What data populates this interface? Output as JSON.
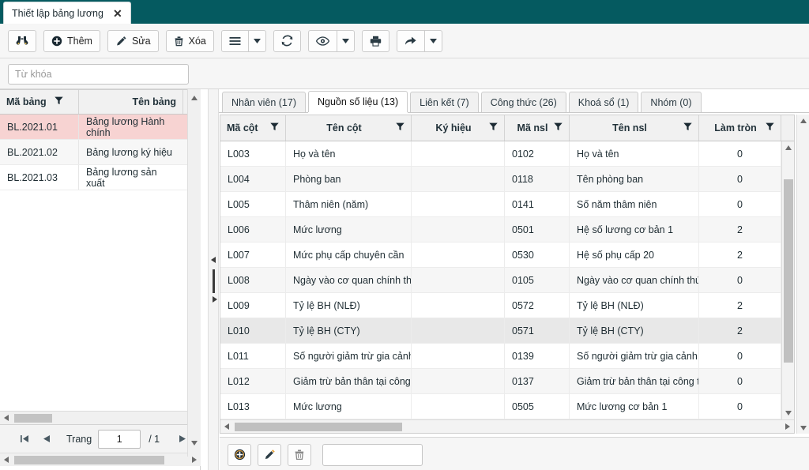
{
  "window": {
    "tab_title": "Thiết lập bảng lương",
    "close_icon": "close-icon",
    "header_color": "#055A60"
  },
  "toolbar": {
    "buttons": [
      {
        "name": "find-button",
        "icon": "binoculars-icon",
        "label": ""
      },
      {
        "name": "add-button",
        "icon": "plus-circle-icon",
        "label": "Thêm"
      },
      {
        "name": "edit-button",
        "icon": "pencil-icon",
        "label": "Sửa"
      },
      {
        "name": "delete-button",
        "icon": "trash-icon",
        "label": "Xóa"
      },
      {
        "name": "menu-button",
        "icon": "hamburger-icon",
        "label": ""
      },
      {
        "name": "refresh-button",
        "icon": "refresh-icon",
        "label": ""
      },
      {
        "name": "view-button",
        "icon": "eye-icon",
        "label": ""
      },
      {
        "name": "print-button",
        "icon": "printer-icon",
        "label": ""
      },
      {
        "name": "export-button",
        "icon": "share-arrow-icon",
        "label": ""
      }
    ],
    "dropdown_icon": "caret-down-icon"
  },
  "search": {
    "placeholder": "Từ khóa",
    "value": ""
  },
  "left_panel": {
    "columns": [
      {
        "label": "Mã bảng",
        "filter_icon": "filter-icon"
      },
      {
        "label": "Tên bảng",
        "filter_icon": "filter-icon"
      }
    ],
    "rows": [
      {
        "ma_bang": "BL.2021.01",
        "ten_bang": "Bảng lương Hành chính",
        "selected": true
      },
      {
        "ma_bang": "BL.2021.02",
        "ten_bang": "Bảng lương ký hiệu",
        "selected": false
      },
      {
        "ma_bang": "BL.2021.03",
        "ten_bang": "Bảng lương sản xuất",
        "selected": false
      }
    ],
    "selected_row_color": "#f7d3d2"
  },
  "pager": {
    "first_icon": "first-page-icon",
    "prev_icon": "prev-page-icon",
    "label": "Trang",
    "page_value": "1",
    "total": "/ 1",
    "next_icon": "next-page-icon"
  },
  "splitter": {
    "collapse_up_icon": "collapse-left-icon",
    "collapse_down_icon": "collapse-right-icon"
  },
  "right_panel": {
    "tabs": [
      {
        "label": "Nhân viên (17)",
        "active": false
      },
      {
        "label": "Nguồn số liệu (13)",
        "active": true
      },
      {
        "label": "Liên kết (7)",
        "active": false
      },
      {
        "label": "Công thức (26)",
        "active": false
      },
      {
        "label": "Khoá sổ (1)",
        "active": false
      },
      {
        "label": "Nhóm (0)",
        "active": false
      }
    ],
    "grid": {
      "columns": [
        {
          "label": "Mã cột",
          "filter_icon": "filter-icon",
          "align": "left"
        },
        {
          "label": "Tên cột",
          "filter_icon": "filter-icon",
          "align": "center"
        },
        {
          "label": "Ký hiệu",
          "filter_icon": "filter-icon",
          "align": "center"
        },
        {
          "label": "Mã nsl",
          "filter_icon": "filter-icon",
          "align": "center"
        },
        {
          "label": "Tên nsl",
          "filter_icon": "filter-icon",
          "align": "center"
        },
        {
          "label": "Làm tròn",
          "filter_icon": "filter-icon",
          "align": "center"
        }
      ],
      "rows": [
        {
          "ma_cot": "L003",
          "ten_cot": "Họ và tên",
          "ky_hieu": "",
          "ma_nsl": "0102",
          "ten_nsl": "Họ và tên",
          "lam_tron": "0"
        },
        {
          "ma_cot": "L004",
          "ten_cot": "Phòng ban",
          "ky_hieu": "",
          "ma_nsl": "0118",
          "ten_nsl": "Tên phòng ban",
          "lam_tron": "0"
        },
        {
          "ma_cot": "L005",
          "ten_cot": "Thâm niên (năm)",
          "ky_hieu": "",
          "ma_nsl": "0141",
          "ten_nsl": "Số năm thâm niên",
          "lam_tron": "0"
        },
        {
          "ma_cot": "L006",
          "ten_cot": "Mức lương",
          "ky_hieu": "",
          "ma_nsl": "0501",
          "ten_nsl": "Hệ số lương cơ bản 1",
          "lam_tron": "2"
        },
        {
          "ma_cot": "L007",
          "ten_cot": "Mức phụ cấp chuyên cần",
          "ky_hieu": "",
          "ma_nsl": "0530",
          "ten_nsl": "Hệ số phụ cấp 20",
          "lam_tron": "2"
        },
        {
          "ma_cot": "L008",
          "ten_cot": "Ngày vào cơ quan chính thức",
          "ky_hieu": "",
          "ma_nsl": "0105",
          "ten_nsl": "Ngày vào cơ quan chính thức",
          "lam_tron": "0"
        },
        {
          "ma_cot": "L009",
          "ten_cot": "Tỷ lệ BH (NLĐ)",
          "ky_hieu": "",
          "ma_nsl": "0572",
          "ten_nsl": "Tỷ lệ BH (NLĐ)",
          "lam_tron": "2"
        },
        {
          "ma_cot": "L010",
          "ten_cot": "Tỷ lệ BH (CTY)",
          "ky_hieu": "",
          "ma_nsl": "0571",
          "ten_nsl": "Tỷ lệ BH (CTY)",
          "lam_tron": "2"
        },
        {
          "ma_cot": "L011",
          "ten_cot": "Số người giảm trừ gia cảnh",
          "ky_hieu": "",
          "ma_nsl": "0139",
          "ten_nsl": "Số người giảm trừ gia cảnh",
          "lam_tron": "0"
        },
        {
          "ma_cot": "L012",
          "ten_cot": "Giảm trừ bản thân tại công ty",
          "ky_hieu": "",
          "ma_nsl": "0137",
          "ten_nsl": "Giảm trừ bản thân tại công ty",
          "lam_tron": "0"
        },
        {
          "ma_cot": "L013",
          "ten_cot": "Mức lương",
          "ky_hieu": "",
          "ma_nsl": "0505",
          "ten_nsl": "Mức lương cơ bản 1",
          "lam_tron": "0"
        }
      ]
    },
    "bottom_toolbar": {
      "add_icon": "plus-circle-icon",
      "edit_icon": "pencil-icon",
      "delete_icon": "trash-icon",
      "input_value": "",
      "input_placeholder": ""
    }
  }
}
